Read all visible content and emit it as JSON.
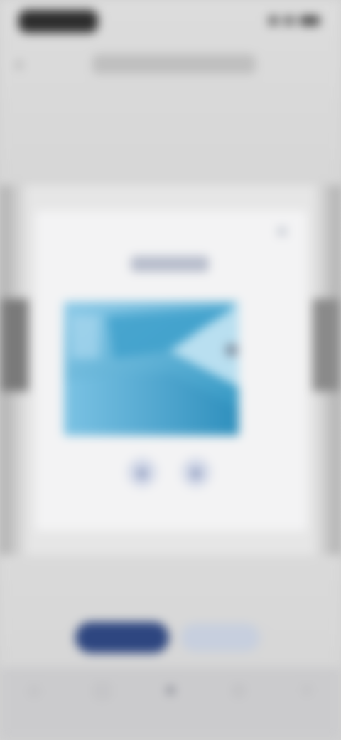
{
  "status_bar": {
    "time": ""
  },
  "nav": {
    "title": ""
  },
  "modal": {
    "title": "",
    "options": [
      {
        "label": "",
        "icon": "option-left-icon"
      },
      {
        "label": "",
        "icon": "option-right-icon"
      }
    ]
  },
  "buttons": {
    "primary_label": "",
    "secondary_label": ""
  },
  "tab_bar": {
    "items": [
      {
        "label": "",
        "icon": "tab-1-icon"
      },
      {
        "label": "",
        "icon": "tab-2-icon"
      },
      {
        "label": "",
        "icon": "tab-3-icon",
        "active": true
      },
      {
        "label": "",
        "icon": "tab-4-icon"
      },
      {
        "label": "",
        "icon": "tab-5-icon"
      }
    ]
  },
  "colors": {
    "primary": "#2e4680",
    "secondary": "#c7cfde",
    "illustration_light": "#8ecbe8",
    "illustration_dark": "#2b93c0"
  }
}
